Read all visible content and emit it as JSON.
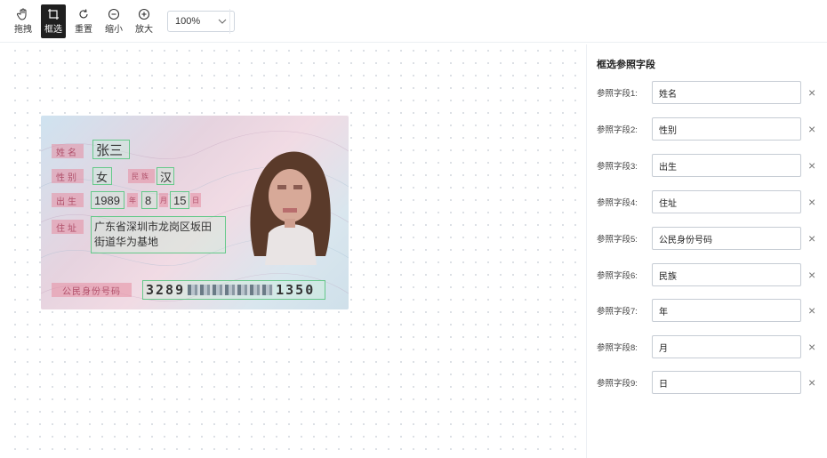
{
  "toolbar": {
    "tools": [
      {
        "label": "拖拽",
        "icon": "hand-icon"
      },
      {
        "label": "框选",
        "icon": "box-select-icon",
        "active": true
      },
      {
        "label": "重置",
        "icon": "reset-icon"
      },
      {
        "label": "缩小",
        "icon": "zoom-out-icon"
      },
      {
        "label": "放大",
        "icon": "zoom-in-icon"
      }
    ],
    "zoom_value": "100%"
  },
  "card": {
    "labels": {
      "name": "姓名",
      "gender": "性别",
      "ethnicity": "民族",
      "birth": "出生",
      "address": "住址",
      "id_number": "公民身份号码",
      "year_unit": "年",
      "month_unit": "月",
      "day_unit": "日"
    },
    "values": {
      "name": "张三",
      "gender": "女",
      "ethnicity": "汉",
      "birth_year": "1989",
      "birth_month": "8",
      "birth_day": "15",
      "address_line1": "广东省深圳市龙岗区坂田",
      "address_line2": "街道华为基地",
      "id_prefix": "3289",
      "id_suffix": "1350"
    }
  },
  "panel": {
    "title": "框选参照字段",
    "fields": [
      {
        "label": "参照字段1:",
        "value": "姓名"
      },
      {
        "label": "参照字段2:",
        "value": "性别"
      },
      {
        "label": "参照字段3:",
        "value": "出生"
      },
      {
        "label": "参照字段4:",
        "value": "住址"
      },
      {
        "label": "参照字段5:",
        "value": "公民身份号码"
      },
      {
        "label": "参照字段6:",
        "value": "民族"
      },
      {
        "label": "参照字段7:",
        "value": "年"
      },
      {
        "label": "参照字段8:",
        "value": "月"
      },
      {
        "label": "参照字段9:",
        "value": "日"
      }
    ],
    "remove_symbol": "×"
  }
}
